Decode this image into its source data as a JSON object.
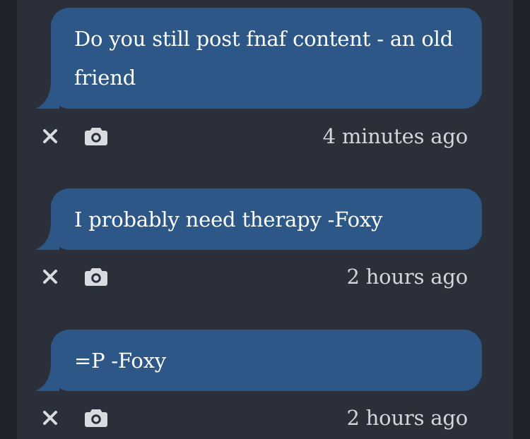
{
  "messages": [
    {
      "text": "Do you still post fnaf content - an old friend",
      "timestamp": "4 minutes ago",
      "delete_icon": "close-icon",
      "photo_icon": "camera-icon"
    },
    {
      "text": "I probably need therapy -Foxy",
      "timestamp": "2 hours ago",
      "delete_icon": "close-icon",
      "photo_icon": "camera-icon"
    },
    {
      "text": "=P -Foxy",
      "timestamp": "2 hours ago",
      "delete_icon": "close-icon",
      "photo_icon": "camera-icon"
    }
  ],
  "colors": {
    "page_background": "#1f2229",
    "column_background": "#2b2f3a",
    "bubble": "#2c5786",
    "bubble_text": "#ffffff",
    "timestamp_text": "#d4d6dc",
    "icon": "#d9dbe0"
  }
}
